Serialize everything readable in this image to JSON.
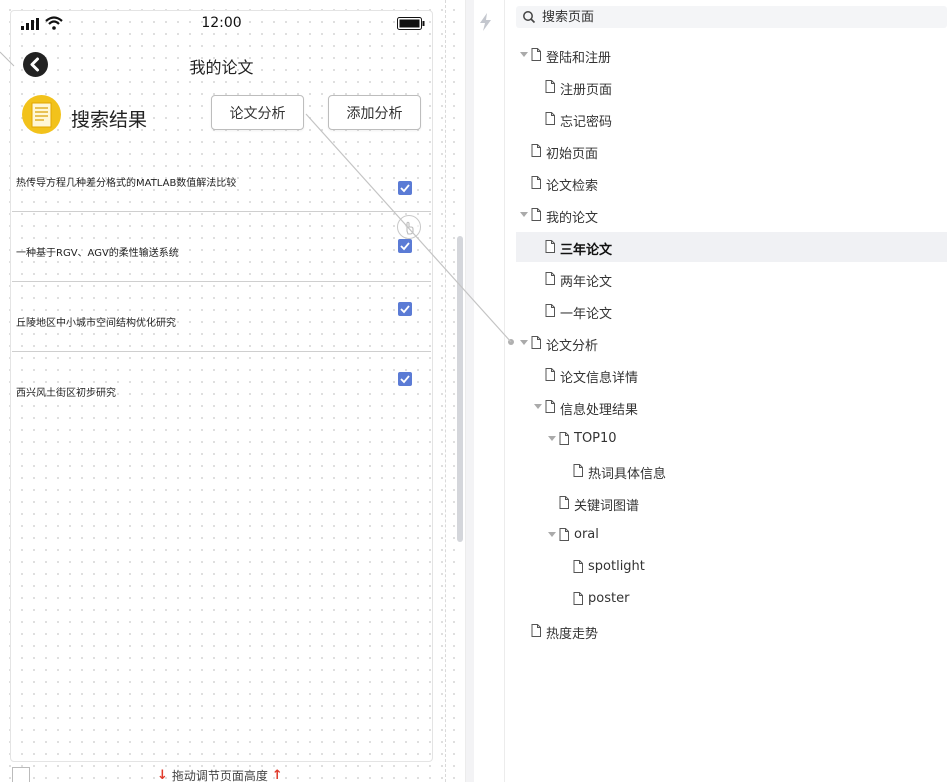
{
  "status_bar": {
    "time": "12:00"
  },
  "phone": {
    "nav_title": "我的论文",
    "results_title": "搜索结果",
    "analyze_button": "论文分析",
    "add_analysis_button": "添加分析",
    "papers": [
      {
        "title": "热传导方程几种差分格式的MATLAB数值解法比较",
        "checked": true
      },
      {
        "title": "一种基于RGV、AGV的柔性输送系统",
        "checked": true
      },
      {
        "title": "丘陵地区中小城市空间结构优化研究",
        "checked": true
      },
      {
        "title": "西兴风土街区初步研究",
        "checked": true
      }
    ]
  },
  "canvas_footer": {
    "resize_hint": "拖动调节页面高度"
  },
  "colors": {
    "accent": "#5b7bd5",
    "logo": "#f2c21b",
    "selected_bg": "#f0f1f4",
    "arrow": "#e03b2c"
  },
  "tree": {
    "search_placeholder": "搜索页面",
    "items": [
      {
        "label": "登陆和注册",
        "level": 0,
        "expanded": true
      },
      {
        "label": "注册页面",
        "level": 1
      },
      {
        "label": "忘记密码",
        "level": 1
      },
      {
        "label": "初始页面",
        "level": 0
      },
      {
        "label": "论文检索",
        "level": 0
      },
      {
        "label": "我的论文",
        "level": 0,
        "expanded": true
      },
      {
        "label": "三年论文",
        "level": 1,
        "selected": true
      },
      {
        "label": "两年论文",
        "level": 1
      },
      {
        "label": "一年论文",
        "level": 1
      },
      {
        "label": "论文分析",
        "level": 0,
        "expanded": true
      },
      {
        "label": "论文信息详情",
        "level": 1
      },
      {
        "label": "信息处理结果",
        "level": 1,
        "expanded": true
      },
      {
        "label": "TOP10",
        "level": 2,
        "expanded": true
      },
      {
        "label": "热词具体信息",
        "level": 3
      },
      {
        "label": "关键词图谱",
        "level": 2
      },
      {
        "label": "oral",
        "level": 2,
        "expanded": true
      },
      {
        "label": "spotlight",
        "level": 3
      },
      {
        "label": "poster",
        "level": 3
      },
      {
        "label": "热度走势",
        "level": 0
      }
    ]
  }
}
